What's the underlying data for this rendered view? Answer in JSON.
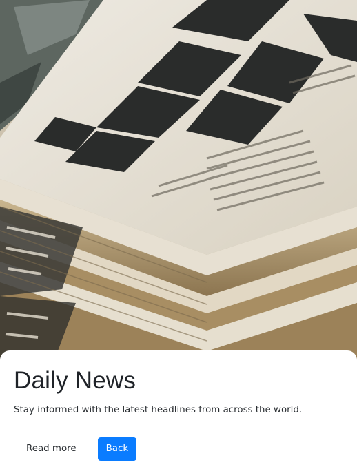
{
  "hero": {
    "image_subject": "newspaper-stack"
  },
  "card": {
    "title": "Daily News",
    "text": "Stay informed with the latest headlines from across the world.",
    "read_more_label": "Read more",
    "back_label": "Back"
  },
  "colors": {
    "primary": "#0a7cff",
    "title_text": "#1f2328",
    "body_text": "#2b2f33"
  }
}
